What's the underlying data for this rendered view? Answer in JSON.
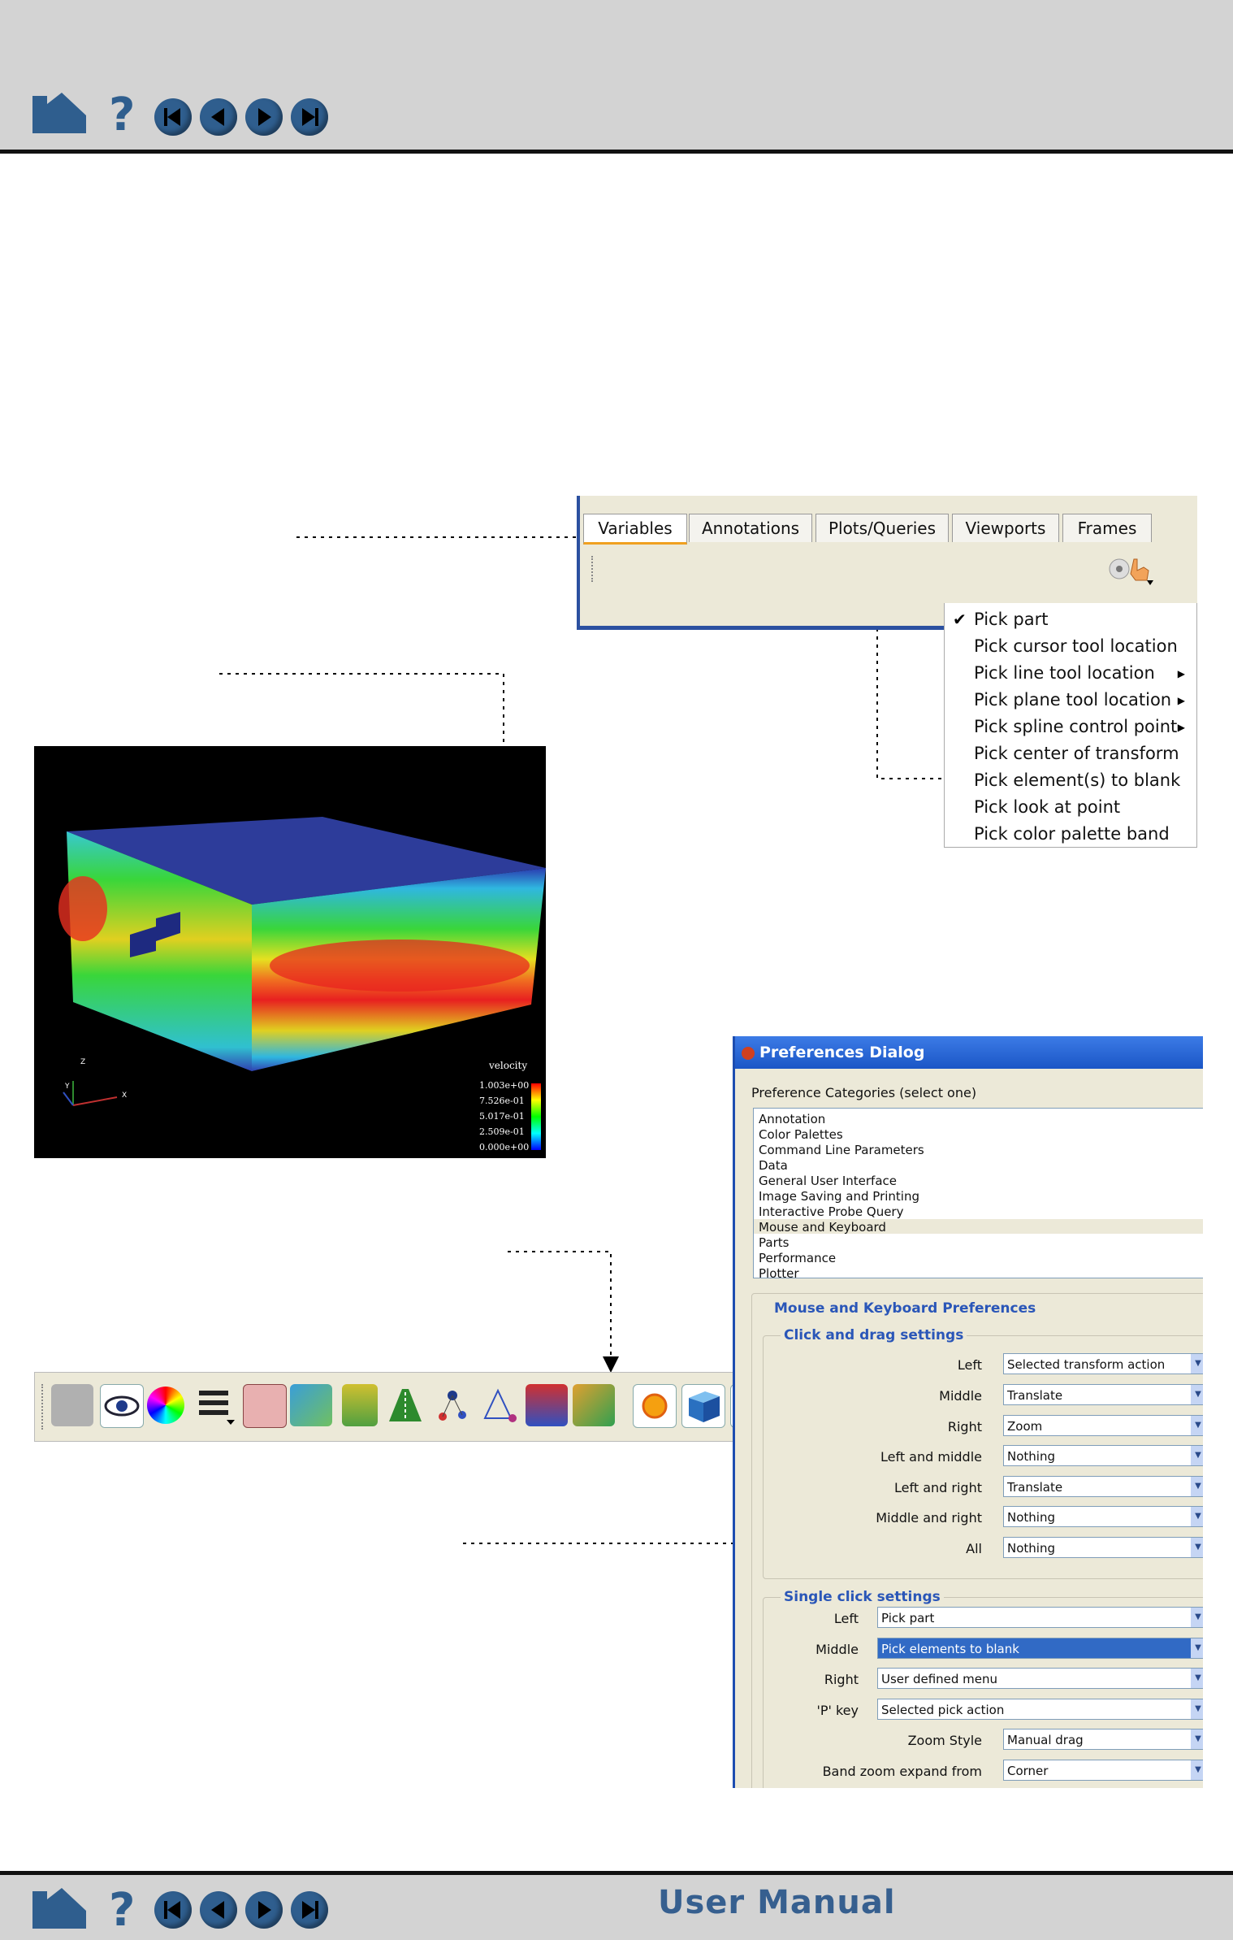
{
  "footer": {
    "title": "User Manual"
  },
  "tabs": [
    "Variables",
    "Annotations",
    "Plots/Queries",
    "Viewports",
    "Frames"
  ],
  "pick_menu": {
    "items": [
      {
        "label": "Pick part",
        "checked": true,
        "submenu": false
      },
      {
        "label": "Pick cursor tool location",
        "checked": false,
        "submenu": false
      },
      {
        "label": "Pick line tool location",
        "checked": false,
        "submenu": true
      },
      {
        "label": "Pick plane tool location",
        "checked": false,
        "submenu": true
      },
      {
        "label": "Pick spline control point",
        "checked": false,
        "submenu": true
      },
      {
        "label": "Pick center of transform",
        "checked": false,
        "submenu": false
      },
      {
        "label": "Pick element(s) to blank",
        "checked": false,
        "submenu": false
      },
      {
        "label": "Pick look at point",
        "checked": false,
        "submenu": false
      },
      {
        "label": "Pick color palette band",
        "checked": false,
        "submenu": false
      }
    ]
  },
  "viewport": {
    "legend_title": "velocity",
    "legend_values": [
      "1.003e+00",
      "7.526e-01",
      "5.017e-01",
      "2.509e-01",
      "0.000e+00"
    ],
    "axis_labels": {
      "z": "Z",
      "y": "Y",
      "x": "X"
    }
  },
  "prefs": {
    "title": "Preferences Dialog",
    "categories_label": "Preference Categories (select one)",
    "categories": [
      "Annotation",
      "Color Palettes",
      "Command Line Parameters",
      "Data",
      "General User Interface",
      "Image Saving and Printing",
      "Interactive Probe Query",
      "Mouse and Keyboard",
      "Parts",
      "Performance",
      "Plotter"
    ],
    "selected_category": "Mouse and Keyboard",
    "section_title": "Mouse and Keyboard Preferences",
    "drag_title": "Click and drag settings",
    "drag_rows": [
      {
        "label": "Left",
        "value": "Selected transform action"
      },
      {
        "label": "Middle",
        "value": "Translate"
      },
      {
        "label": "Right",
        "value": "Zoom"
      },
      {
        "label": "Left and middle",
        "value": "Nothing"
      },
      {
        "label": "Left and right",
        "value": "Translate"
      },
      {
        "label": "Middle and right",
        "value": "Nothing"
      },
      {
        "label": "All",
        "value": "Nothing"
      }
    ],
    "click_title": "Single click settings",
    "click_rows": [
      {
        "label": "Left",
        "value": "Pick part"
      },
      {
        "label": "Middle",
        "value": "Pick elements to blank",
        "highlight": true
      },
      {
        "label": "Right",
        "value": "User defined menu"
      },
      {
        "label": "'P' key",
        "value": "Selected pick action"
      },
      {
        "label": "Zoom Style",
        "value": "Manual drag"
      },
      {
        "label": "Band zoom expand from",
        "value": "Corner"
      }
    ]
  },
  "colors": {
    "header_bg": "#d3d3d3",
    "nav_blue": "#2f5e8e",
    "highlight": "#316ac5"
  }
}
